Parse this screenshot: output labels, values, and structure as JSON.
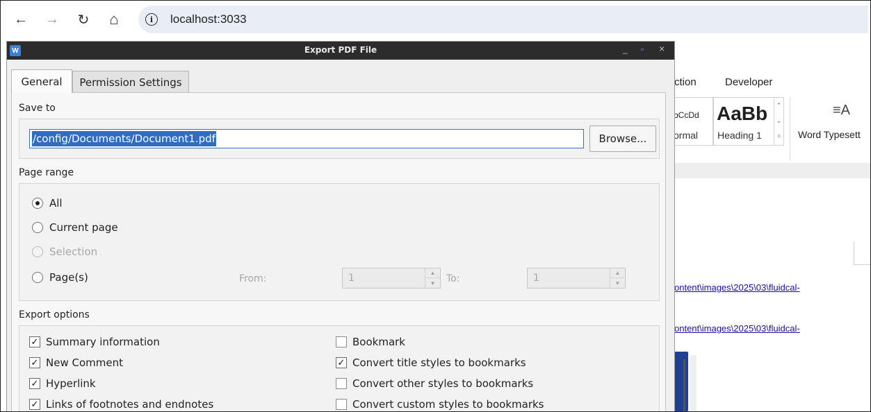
{
  "browser": {
    "back_icon": "←",
    "forward_icon": "→",
    "reload_icon": "↻",
    "home_icon": "⌂",
    "info_icon": "i",
    "url": "localhost:3033"
  },
  "background_app": {
    "tabs": [
      "ction",
      "Developer"
    ],
    "styles": [
      {
        "preview": "bCcDd",
        "name": "ormal"
      },
      {
        "preview": "AaBb",
        "name": "Heading 1"
      }
    ],
    "typeset_icon": "≡A",
    "typeset_label": "Word Typesett",
    "links": [
      "ontent\\images\\2025\\03\\fluidcal-",
      "ontent\\images\\2025\\03\\fluidcal-"
    ]
  },
  "dialog": {
    "title": "Export PDF File",
    "app_icon": "W",
    "minimize": "_",
    "maximize": "▫",
    "close": "×",
    "tabs": [
      {
        "label": "General",
        "active": true
      },
      {
        "label": "Permission Settings",
        "active": false
      }
    ],
    "save_to": {
      "label": "Save to",
      "path": "/config/Documents/Document1.pdf",
      "browse_label": "Browse..."
    },
    "page_range": {
      "label": "Page range",
      "options": [
        {
          "label": "All",
          "selected": true,
          "enabled": true
        },
        {
          "label": "Current page",
          "selected": false,
          "enabled": true
        },
        {
          "label": "Selection",
          "selected": false,
          "enabled": false
        },
        {
          "label": "Page(s)",
          "selected": false,
          "enabled": true
        }
      ],
      "from_label": "From:",
      "from_value": "1",
      "to_label": "To:",
      "to_value": "1"
    },
    "export_options": {
      "label": "Export options",
      "left": [
        {
          "label": "Summary information",
          "checked": true
        },
        {
          "label": "New Comment",
          "checked": true
        },
        {
          "label": "Hyperlink",
          "checked": true
        },
        {
          "label": "Links of footnotes and endnotes",
          "checked": true
        }
      ],
      "right": [
        {
          "label": "Bookmark",
          "checked": false
        },
        {
          "label": "Convert title styles to bookmarks",
          "checked": true
        },
        {
          "label": "Convert other styles to bookmarks",
          "checked": false
        },
        {
          "label": "Convert custom styles to bookmarks",
          "checked": false
        }
      ],
      "check_glyph": "✓"
    }
  }
}
